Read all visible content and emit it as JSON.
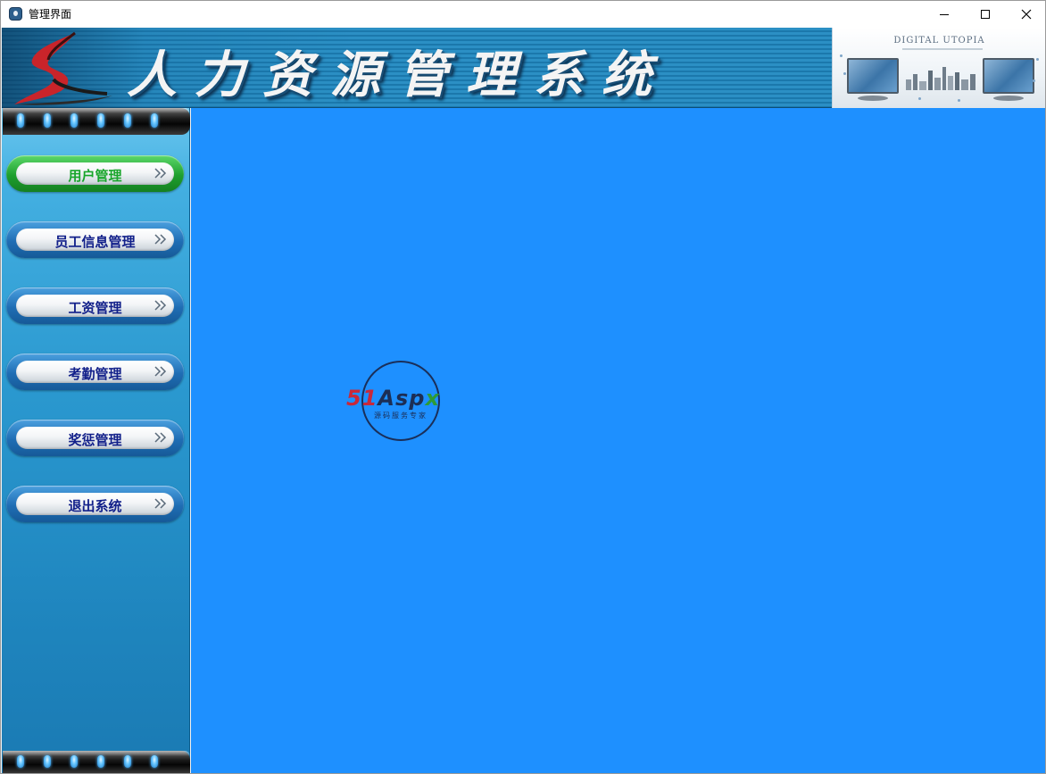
{
  "window": {
    "title": "管理界面",
    "minimize_icon": "minimize-icon",
    "maximize_icon": "maximize-icon",
    "close_icon": "close-icon"
  },
  "header": {
    "system_title": "人力资源管理系统",
    "art_caption": "DIGITAL UTOPIA",
    "logo_icon": "swirl-s-logo-icon"
  },
  "sidebar": {
    "items": [
      {
        "label": "用户管理",
        "active": true,
        "icon": "double-chevron-right-icon"
      },
      {
        "label": "员工信息管理",
        "active": false,
        "icon": "double-chevron-right-icon"
      },
      {
        "label": "工资管理",
        "active": false,
        "icon": "double-chevron-right-icon"
      },
      {
        "label": "考勤管理",
        "active": false,
        "icon": "double-chevron-right-icon"
      },
      {
        "label": "奖惩管理",
        "active": false,
        "icon": "double-chevron-right-icon"
      },
      {
        "label": "退出系统",
        "active": false,
        "icon": "double-chevron-right-icon"
      }
    ]
  },
  "content": {
    "watermark_51": "51",
    "watermark_asp": "Asp",
    "watermark_x": "x",
    "watermark_sub": "源码服务专家"
  },
  "colors": {
    "content_background": "#1e90ff",
    "menu_active": "#18a52a",
    "menu_text": "#12208a"
  }
}
